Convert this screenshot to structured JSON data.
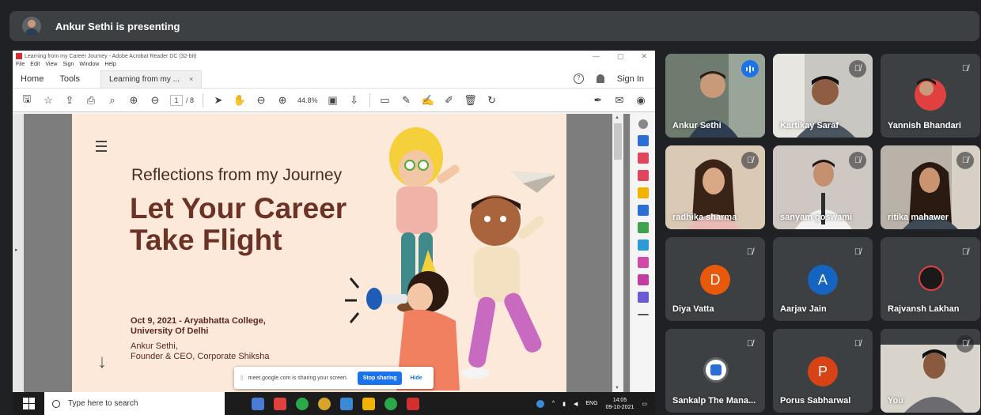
{
  "banner": {
    "text": "Ankur Sethi is presenting"
  },
  "acrobat": {
    "window_title": "Learning from my Career Journey - Adobe Acrobat Reader DC (32-bit)",
    "menu": [
      "File",
      "Edit",
      "View",
      "Sign",
      "Window",
      "Help"
    ],
    "tabs": {
      "home": "Home",
      "tools": "Tools",
      "doc": "Learning from my ...",
      "close": "×"
    },
    "help": "?",
    "sign_in": "Sign In",
    "page_current": "1",
    "page_total": "/ 8",
    "zoom": "44.8%"
  },
  "slide": {
    "subtitle": "Reflections from my Journey",
    "headline_1": "Let Your Career",
    "headline_2": "Take Flight",
    "date_1": "Oct 9, 2021 - Aryabhatta College,",
    "date_2": "University Of Delhi",
    "author_1": "Ankur Sethi,",
    "author_2": "Founder & CEO, Corporate Shiksha",
    "down": "↓"
  },
  "sharing": {
    "grip": "||",
    "message": "meet.google.com is sharing your screen.",
    "stop": "Stop sharing",
    "hide": "Hide"
  },
  "taskbar": {
    "search_placeholder": "Type here to search",
    "lang": "ENG",
    "time": "14:05",
    "date": "09-10-2021"
  },
  "participants": [
    {
      "name": "Ankur Sethi"
    },
    {
      "name": "Kartikay Saraf"
    },
    {
      "name": "Yannish Bhandari"
    },
    {
      "name": "radhika sharma"
    },
    {
      "name": "sanyam goswami"
    },
    {
      "name": "ritika mahawer"
    },
    {
      "name": "Diya Vatta",
      "initial": "D",
      "color": "#e8590c"
    },
    {
      "name": "Aarjav Jain",
      "initial": "A",
      "color": "#1565c0"
    },
    {
      "name": "Rajvansh Lakhan"
    },
    {
      "name": "Sankalp The Mana..."
    },
    {
      "name": "Porus Sabharwal",
      "initial": "P",
      "color": "#d84315"
    },
    {
      "name": "You"
    }
  ],
  "icons": {
    "mic_off": "mic-off-icon",
    "speaking": "speaking-indicator-icon"
  },
  "colors": {
    "meet_bg": "#202124",
    "tile_bg": "#3c4043",
    "accent": "#1a73e8",
    "headline": "#6b3226"
  }
}
